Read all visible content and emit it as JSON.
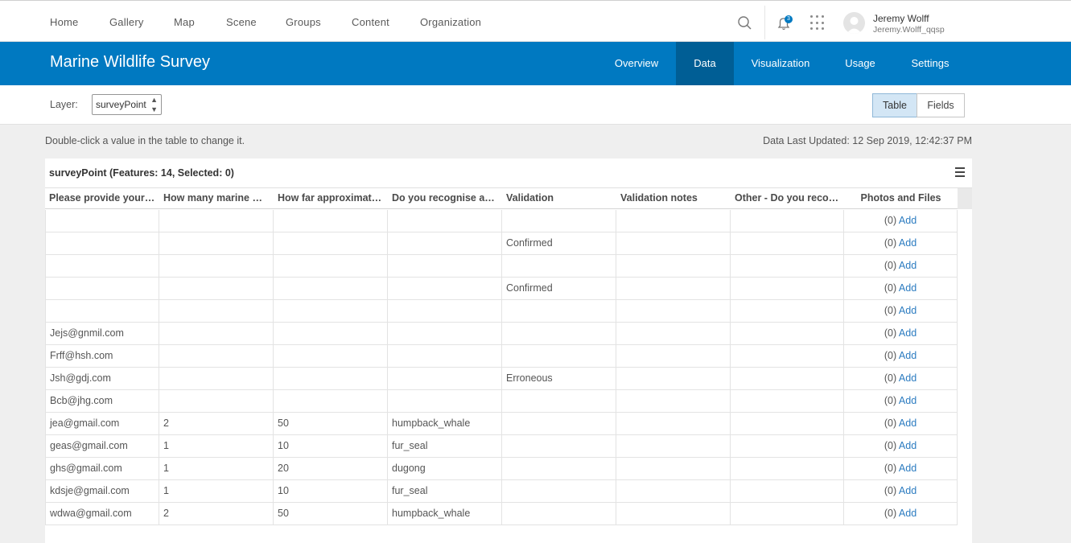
{
  "topnav": {
    "links": [
      "Home",
      "Gallery",
      "Map",
      "Scene",
      "Groups",
      "Content",
      "Organization"
    ],
    "notification_count": "3",
    "user_name": "Jeremy Wolff",
    "user_id": "Jeremy.Wolff_qqsp"
  },
  "item": {
    "title": "Marine Wildlife Survey",
    "tabs": [
      "Overview",
      "Data",
      "Visualization",
      "Usage",
      "Settings"
    ],
    "active_tab": "Data"
  },
  "layer": {
    "label": "Layer:",
    "selected": "surveyPoint",
    "view_table": "Table",
    "view_fields": "Fields",
    "active_view": "Table"
  },
  "info": {
    "hint": "Double-click a value in the table to change it.",
    "updated": "Data Last Updated: 12 Sep 2019, 12:42:37 PM"
  },
  "table": {
    "title": "surveyPoint (Features: 14, Selected: 0)",
    "columns": [
      "Please provide your…",
      "How many marine …",
      "How far approximat…",
      "Do you recognise a…",
      "Validation",
      "Validation notes",
      "Other - Do you reco…",
      "Photos and Files"
    ],
    "attachment_count": "(0)",
    "attachment_link": "Add",
    "rows": [
      [
        "",
        "",
        "",
        "",
        "",
        "",
        ""
      ],
      [
        "",
        "",
        "",
        "",
        "Confirmed",
        "",
        ""
      ],
      [
        "",
        "",
        "",
        "",
        "",
        "",
        ""
      ],
      [
        "",
        "",
        "",
        "",
        "Confirmed",
        "",
        ""
      ],
      [
        "",
        "",
        "",
        "",
        "",
        "",
        ""
      ],
      [
        "Jejs@gnmil.com",
        "",
        "",
        "",
        "",
        "",
        ""
      ],
      [
        "Frff@hsh.com",
        "",
        "",
        "",
        "",
        "",
        ""
      ],
      [
        "Jsh@gdj.com",
        "",
        "",
        "",
        "Erroneous",
        "",
        ""
      ],
      [
        "Bcb@jhg.com",
        "",
        "",
        "",
        "",
        "",
        ""
      ],
      [
        "jea@gmail.com",
        "2",
        "50",
        "humpback_whale",
        "",
        "",
        ""
      ],
      [
        "geas@gmail.com",
        "1",
        "10",
        "fur_seal",
        "",
        "",
        ""
      ],
      [
        "ghs@gmail.com",
        "1",
        "20",
        "dugong",
        "",
        "",
        ""
      ],
      [
        "kdsje@gmail.com",
        "1",
        "10",
        "fur_seal",
        "",
        "",
        ""
      ],
      [
        "wdwa@gmail.com",
        "2",
        "50",
        "humpback_whale",
        "",
        "",
        ""
      ]
    ]
  },
  "colors": {
    "brand_blue": "#0079c1",
    "active_tab": "#005e95",
    "link": "#2b7bc0"
  },
  "icons": [
    "search-icon",
    "bell-icon",
    "apps-icon",
    "avatar",
    "menu-icon",
    "dropdown-arrow-icon"
  ]
}
